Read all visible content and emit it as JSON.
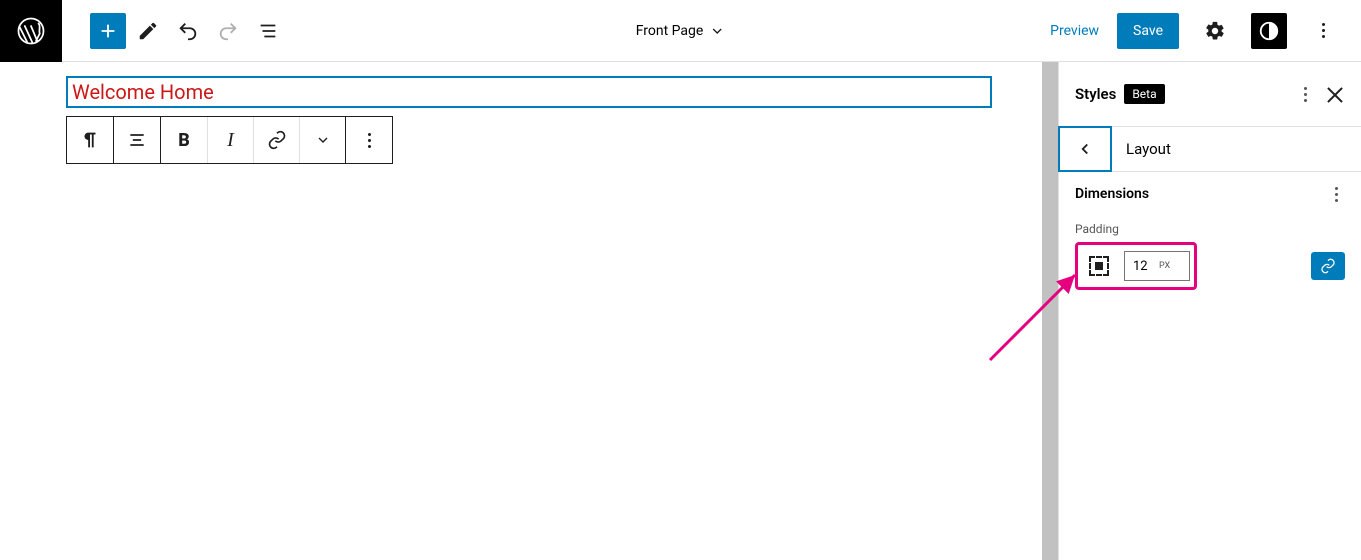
{
  "colors": {
    "accent": "#007cba",
    "highlight": "#e6007e",
    "text_accent": "#cc1818"
  },
  "header": {
    "document_title": "Front Page",
    "preview_label": "Preview",
    "save_label": "Save"
  },
  "editor": {
    "block_text": "Welcome Home"
  },
  "sidebar": {
    "panel_title": "Styles",
    "beta_label": "Beta",
    "nav_title": "Layout",
    "section_title": "Dimensions",
    "padding": {
      "label": "Padding",
      "value": "12",
      "unit": "PX"
    }
  }
}
